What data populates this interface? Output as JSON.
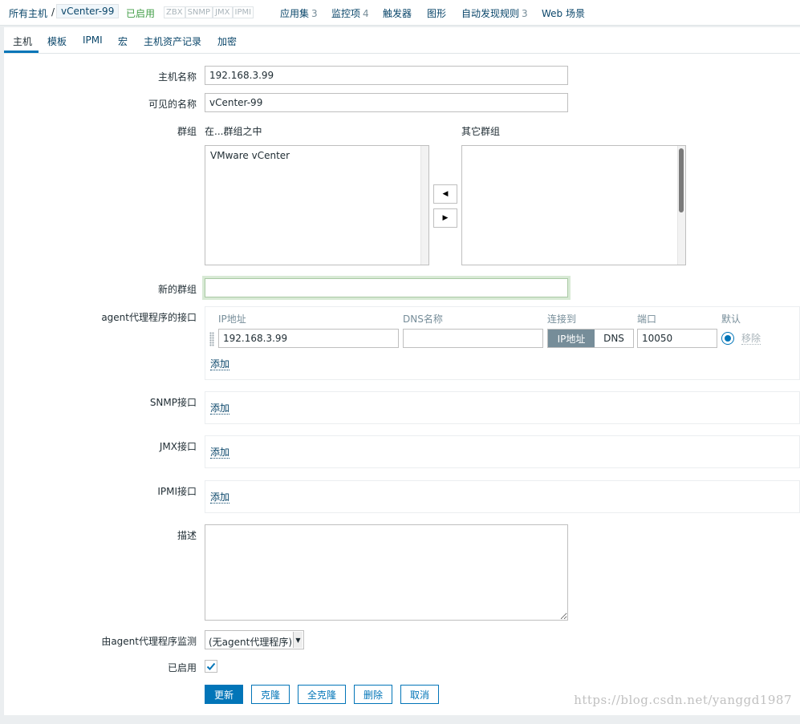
{
  "breadcrumb": {
    "all_hosts": "所有主机",
    "sep": "/",
    "current_host": "vCenter-99"
  },
  "host_status": "已启用",
  "availability": [
    "ZBX",
    "SNMP",
    "JMX",
    "IPMI"
  ],
  "header_links": {
    "applications": {
      "label": "应用集",
      "count": "3"
    },
    "items": {
      "label": "监控项",
      "count": "4"
    },
    "triggers": {
      "label": "触发器"
    },
    "graphs": {
      "label": "图形"
    },
    "discovery": {
      "label": "自动发现规则",
      "count": "3"
    },
    "web": {
      "label": "Web 场景"
    }
  },
  "tabs": [
    "主机",
    "模板",
    "IPMI",
    "宏",
    "主机资产记录",
    "加密"
  ],
  "form": {
    "host_name_label": "主机名称",
    "host_name_value": "192.168.3.99",
    "visible_name_label": "可见的名称",
    "visible_name_value": "vCenter-99",
    "groups_label": "群组",
    "in_groups_label": "在...群组之中",
    "other_groups_label": "其它群组",
    "in_groups": [
      "VMware vCenter"
    ],
    "new_group_label": "新的群组",
    "new_group_value": "",
    "agent_interfaces_label": "agent代理程序的接口",
    "iface_headers": {
      "ip": "IP地址",
      "dns": "DNS名称",
      "connect_to": "连接到",
      "port": "端口",
      "default": "默认"
    },
    "agent_interface": {
      "ip": "192.168.3.99",
      "dns": "",
      "connect_ip": "IP地址",
      "connect_dns": "DNS",
      "port": "10050",
      "remove": "移除"
    },
    "add_label": "添加",
    "snmp_label": "SNMP接口",
    "jmx_label": "JMX接口",
    "ipmi_label": "IPMI接口",
    "description_label": "描述",
    "description_value": "",
    "proxy_label": "由agent代理程序监测",
    "proxy_value": "(无agent代理程序)",
    "enabled_label": "已启用",
    "enabled": true
  },
  "buttons": {
    "update": "更新",
    "clone": "克隆",
    "full_clone": "全克隆",
    "delete": "删除",
    "cancel": "取消"
  },
  "watermark": "https://blog.csdn.net/yanggd1987",
  "colors": {
    "primary": "#0275b8",
    "link": "#0a466a",
    "enabled_green": "#429e47",
    "segment_active": "#768d99"
  }
}
